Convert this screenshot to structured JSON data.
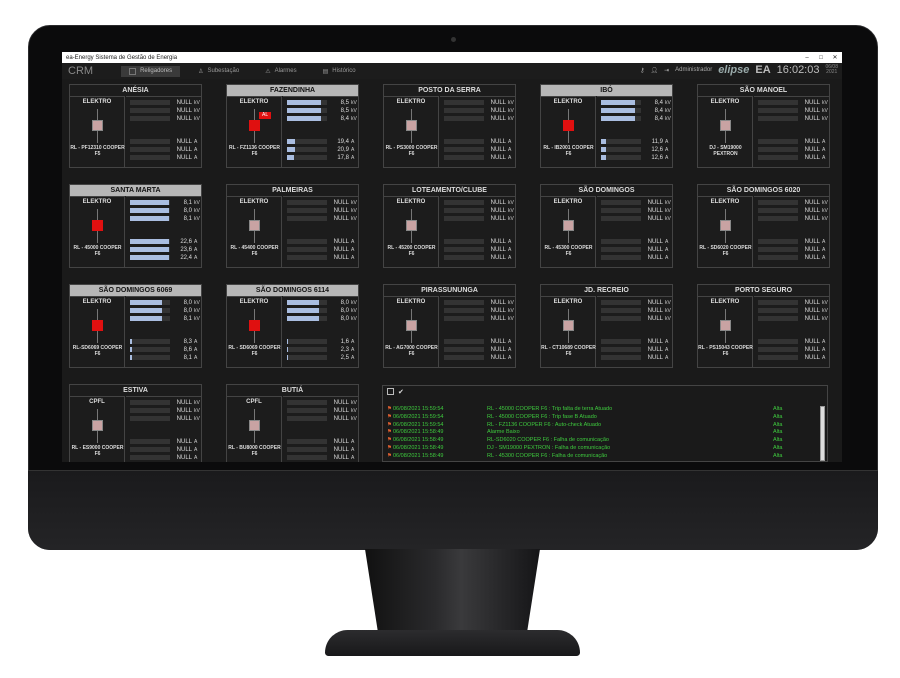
{
  "window": {
    "title": "ea-Energy Sistema de Gestão de Energia",
    "min": "–",
    "max": "□",
    "close": "✕"
  },
  "topbar": {
    "app": "CRM",
    "tabs": [
      "Religadores",
      "Subestação",
      "Alarmes",
      "Histórico"
    ],
    "user": "Administrador",
    "logo": "elipse",
    "brand": "EA",
    "brand_sub": "Energy Assistance",
    "clock": "16:02:03",
    "date": "06/08\n2021"
  },
  "cards": [
    {
      "title": "ANÉSIA",
      "org": "ELEKTRO",
      "device": "RL - PF12310 COOPER F5",
      "alarm": false,
      "kv": [
        "NULL",
        "NULL",
        "NULL"
      ],
      "a": [
        "NULL",
        "NULL",
        "NULL"
      ],
      "kv_fill": [
        0,
        0,
        0
      ],
      "a_fill": [
        0,
        0,
        0
      ]
    },
    {
      "title": "FAZENDINHA",
      "org": "ELEKTRO",
      "device": "RL - FZ1136 COOPER F6",
      "alarm": true,
      "tag": "AL",
      "kv": [
        "8,5",
        "8,5",
        "8,4"
      ],
      "a": [
        "19,4",
        "20,9",
        "17,8"
      ],
      "kv_fill": [
        0.85,
        0.85,
        0.84
      ],
      "a_fill": [
        0.2,
        0.21,
        0.18
      ]
    },
    {
      "title": "POSTO DA SERRA",
      "org": "ELEKTRO",
      "device": "RL - PS3000 COOPER F6",
      "alarm": false,
      "kv": [
        "NULL",
        "NULL",
        "NULL"
      ],
      "a": [
        "NULL",
        "NULL",
        "NULL"
      ],
      "kv_fill": [
        0,
        0,
        0
      ],
      "a_fill": [
        0,
        0,
        0
      ]
    },
    {
      "title": "IBÓ",
      "org": "ELEKTRO",
      "device": "RL - IB2001 COOPER F6",
      "alarm": true,
      "kv": [
        "8,4",
        "8,4",
        "8,4"
      ],
      "a": [
        "11,9",
        "12,6",
        "12,6"
      ],
      "kv_fill": [
        0.84,
        0.84,
        0.84
      ],
      "a_fill": [
        0.12,
        0.13,
        0.13
      ]
    },
    {
      "title": "SÃO MANOEL",
      "org": "ELEKTRO",
      "device": "DJ - SM19000 PEXTRON",
      "alarm": false,
      "kv": [
        "NULL",
        "NULL",
        "NULL"
      ],
      "a": [
        "NULL",
        "NULL",
        "NULL"
      ],
      "kv_fill": [
        0,
        0,
        0
      ],
      "a_fill": [
        0,
        0,
        0
      ]
    },
    {
      "title": "SANTA MARTA",
      "org": "ELEKTRO",
      "device": "RL - 45000 COOPER F6",
      "alarm": true,
      "kv": [
        "8,1",
        "8,0",
        "8,1"
      ],
      "a": [
        "22,6",
        "23,6",
        "22,4"
      ],
      "kv_fill": [
        0.98,
        0.98,
        0.98
      ],
      "a_fill": [
        0.98,
        0.98,
        0.98
      ]
    },
    {
      "title": "PALMEIRAS",
      "org": "ELEKTRO",
      "device": "RL - 45400 COOPER F6",
      "alarm": false,
      "kv": [
        "NULL",
        "NULL",
        "NULL"
      ],
      "a": [
        "NULL",
        "NULL",
        "NULL"
      ],
      "kv_fill": [
        0,
        0,
        0
      ],
      "a_fill": [
        0,
        0,
        0
      ]
    },
    {
      "title": "LOTEAMENTO/CLUBE",
      "org": "ELEKTRO",
      "device": "RL - 45200 COOPER F6",
      "alarm": false,
      "kv": [
        "NULL",
        "NULL",
        "NULL"
      ],
      "a": [
        "NULL",
        "NULL",
        "NULL"
      ],
      "kv_fill": [
        0,
        0,
        0
      ],
      "a_fill": [
        0,
        0,
        0
      ]
    },
    {
      "title": "SÃO DOMINGOS",
      "org": "ELEKTRO",
      "device": "RL - 45300 COOPER F6",
      "alarm": false,
      "kv": [
        "NULL",
        "NULL",
        "NULL"
      ],
      "a": [
        "NULL",
        "NULL",
        "NULL"
      ],
      "kv_fill": [
        0,
        0,
        0
      ],
      "a_fill": [
        0,
        0,
        0
      ]
    },
    {
      "title": "SÃO DOMINGOS 6020",
      "org": "ELEKTRO",
      "device": "RL - SD6020 COOPER F6",
      "alarm": false,
      "kv": [
        "NULL",
        "NULL",
        "NULL"
      ],
      "a": [
        "NULL",
        "NULL",
        "NULL"
      ],
      "kv_fill": [
        0,
        0,
        0
      ],
      "a_fill": [
        0,
        0,
        0
      ]
    },
    {
      "title": "SÃO DOMINGOS 6069",
      "org": "ELEKTRO",
      "device": "RL-SD6069 COOPER F6",
      "alarm": true,
      "kv": [
        "8,0",
        "8,0",
        "8,1"
      ],
      "a": [
        "8,3",
        "8,6",
        "8,1"
      ],
      "kv_fill": [
        0.8,
        0.8,
        0.81
      ],
      "a_fill": [
        0.05,
        0.05,
        0.05
      ]
    },
    {
      "title": "SÃO DOMINGOS 6114",
      "org": "ELEKTRO",
      "device": "RL - SD6069 COOPER F6",
      "alarm": true,
      "kv": [
        "8,0",
        "8,0",
        "8,0"
      ],
      "a": [
        "1,6",
        "2,3",
        "2,5"
      ],
      "kv_fill": [
        0.8,
        0.8,
        0.8
      ],
      "a_fill": [
        0.02,
        0.02,
        0.02
      ]
    },
    {
      "title": "PIRASSUNUNGA",
      "org": "ELEKTRO",
      "device": "RL - AG7000 COOPER F6",
      "alarm": false,
      "kv": [
        "NULL",
        "NULL",
        "NULL"
      ],
      "a": [
        "NULL",
        "NULL",
        "NULL"
      ],
      "kv_fill": [
        0,
        0,
        0
      ],
      "a_fill": [
        0,
        0,
        0
      ]
    },
    {
      "title": "JD. RECREIO",
      "org": "ELEKTRO",
      "device": "RL - CT10689 COOPER F6",
      "alarm": false,
      "kv": [
        "NULL",
        "NULL",
        "NULL"
      ],
      "a": [
        "NULL",
        "NULL",
        "NULL"
      ],
      "kv_fill": [
        0,
        0,
        0
      ],
      "a_fill": [
        0,
        0,
        0
      ]
    },
    {
      "title": "PORTO SEGURO",
      "org": "ELEKTRO",
      "device": "RL - PS15043 COOPER F6",
      "alarm": false,
      "kv": [
        "NULL",
        "NULL",
        "NULL"
      ],
      "a": [
        "NULL",
        "NULL",
        "NULL"
      ],
      "kv_fill": [
        0,
        0,
        0
      ],
      "a_fill": [
        0,
        0,
        0
      ]
    },
    {
      "title": "ESTIVA",
      "org": "CPFL",
      "device": "RL - ES9000 COOPER F6",
      "alarm": false,
      "kv": [
        "NULL",
        "NULL",
        "NULL"
      ],
      "a": [
        "NULL",
        "NULL",
        "NULL"
      ],
      "kv_fill": [
        0,
        0,
        0
      ],
      "a_fill": [
        0,
        0,
        0
      ]
    },
    {
      "title": "BUTIÁ",
      "org": "CPFL",
      "device": "RL - BU8000 COOPER F6",
      "alarm": false,
      "kv": [
        "NULL",
        "NULL",
        "NULL"
      ],
      "a": [
        "NULL",
        "NULL",
        "NULL"
      ],
      "kv_fill": [
        0,
        0,
        0
      ],
      "a_fill": [
        0,
        0,
        0
      ]
    }
  ],
  "units": {
    "kv": "kV",
    "a": "A"
  },
  "events": [
    {
      "date": "06/08/2021 15:59:54",
      "msg": "RL - 45000 COOPER F6 : Trip falta de terra Atuado",
      "sev": "Alta"
    },
    {
      "date": "06/08/2021 15:59:54",
      "msg": "RL - 45000 COOPER F6 : Trip fase B Atuado",
      "sev": "Alta"
    },
    {
      "date": "06/08/2021 15:59:54",
      "msg": "RL - FZ1136 COOPER F6 : Auto-check Atuado",
      "sev": "Alta"
    },
    {
      "date": "06/08/2021 15:58:49",
      "msg": "Alarme Baixo",
      "sev": "Alta"
    },
    {
      "date": "06/08/2021 15:58:49",
      "msg": "RL-SD6020 COOPER F6 : Falha de comunicação",
      "sev": "Alta"
    },
    {
      "date": "06/08/2021 15:58:49",
      "msg": "DJ - SM19000 PEXTRON : Falha de comunicação",
      "sev": "Alta"
    },
    {
      "date": "06/08/2021 15:58:49",
      "msg": "RL - 45300 COOPER F6 : Falha de comunicação",
      "sev": "Alta"
    }
  ]
}
